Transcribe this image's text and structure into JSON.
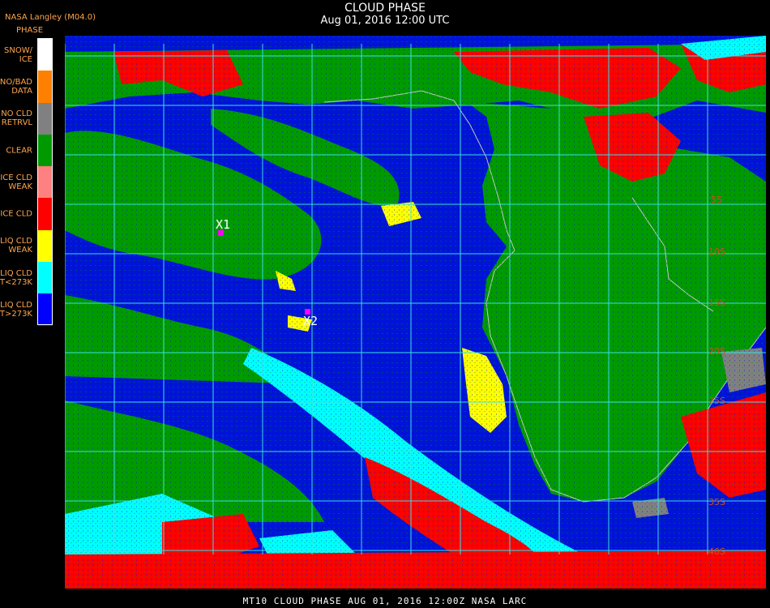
{
  "header": {
    "title": "CLOUD PHASE",
    "subtitle": "Aug 01, 2016 12:00 UTC",
    "producer": "NASA Langley (M04.0)"
  },
  "legend": {
    "title": "PHASE",
    "items": [
      {
        "line1": "SNOW/",
        "line2": "ICE",
        "color": "#ffffff"
      },
      {
        "line1": "NO/BAD",
        "line2": "DATA",
        "color": "#ff8000"
      },
      {
        "line1": "NO CLD",
        "line2": "RETRVL",
        "color": "#808080"
      },
      {
        "line1": "CLEAR",
        "line2": "",
        "color": "#009a00"
      },
      {
        "line1": "ICE CLD",
        "line2": "WEAK",
        "color": "#ff8080"
      },
      {
        "line1": "ICE CLD",
        "line2": "",
        "color": "#ff0000"
      },
      {
        "line1": "LIQ CLD",
        "line2": "WEAK",
        "color": "#ffff00"
      },
      {
        "line1": "LIQ CLD",
        "line2": "T<273K",
        "color": "#00ffff"
      },
      {
        "line1": "LIQ CLD",
        "line2": "T>273K",
        "color": "#0000ff"
      }
    ]
  },
  "map": {
    "latitude_labels": [
      "5S",
      "10S",
      "15S",
      "20S",
      "25S",
      "35S",
      "40S"
    ],
    "markers": [
      {
        "label": "X1"
      },
      {
        "label": "X2"
      }
    ]
  },
  "footer": {
    "text": "MT10   CLOUD PHASE    AUG 01, 2016 12:00Z   NASA LARC"
  }
}
